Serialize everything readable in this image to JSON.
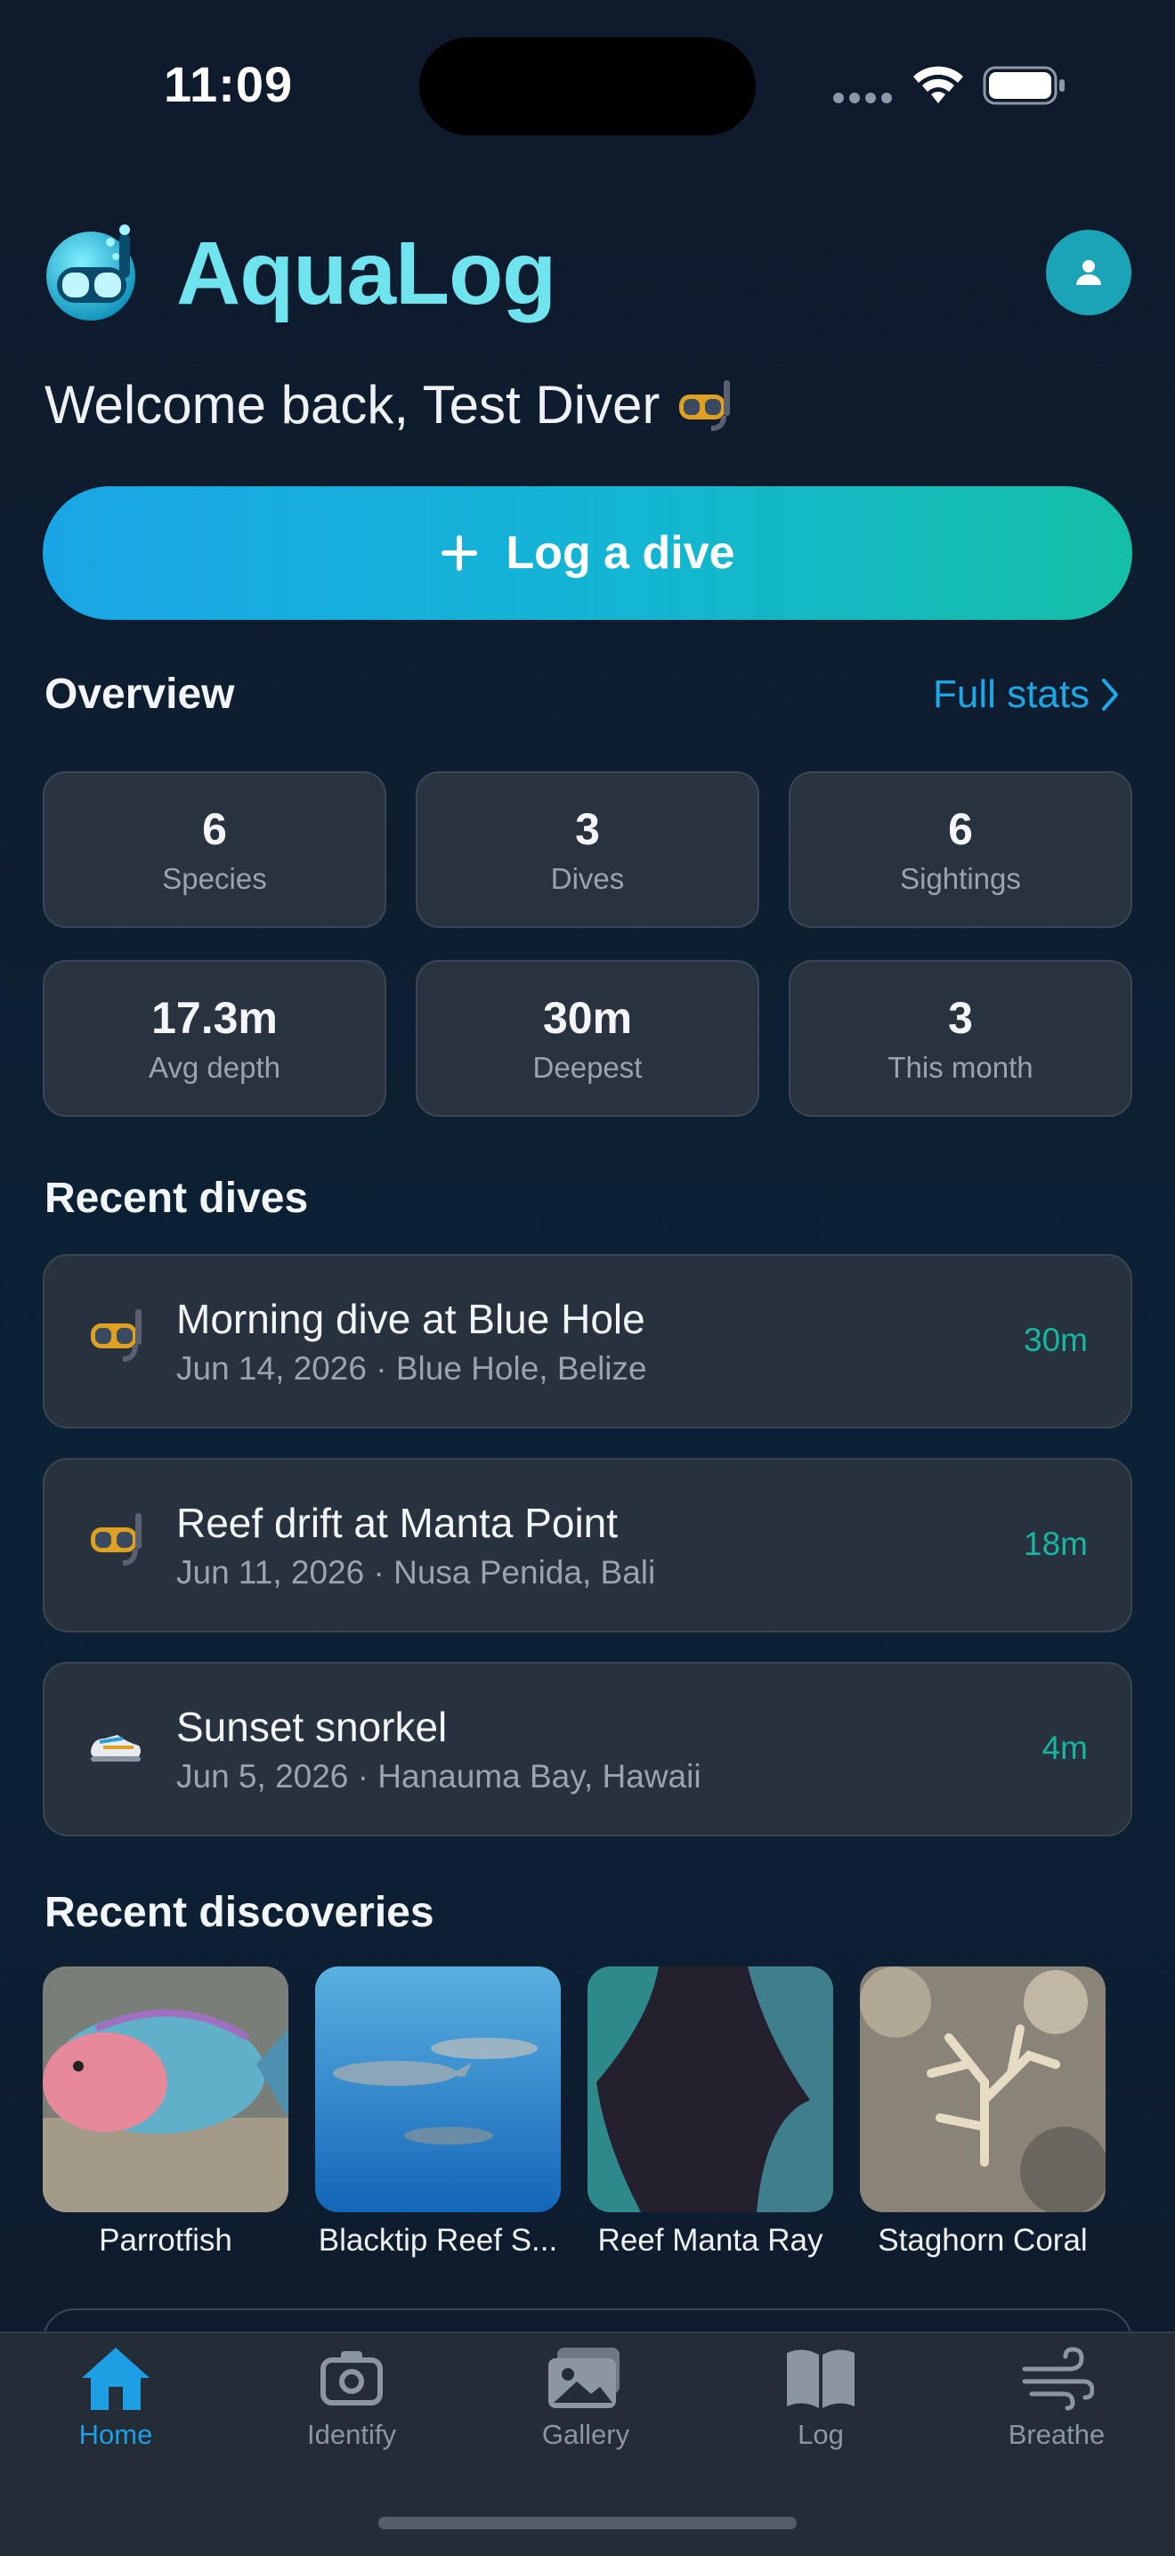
{
  "status_bar": {
    "time": "11:09"
  },
  "header": {
    "app_title": "AquaLog",
    "welcome": "Welcome back, Test Diver"
  },
  "actions": {
    "log_dive_label": "Log a dive"
  },
  "overview": {
    "title": "Overview",
    "full_stats_label": "Full stats",
    "stats": [
      {
        "value": "6",
        "label": "Species"
      },
      {
        "value": "3",
        "label": "Dives"
      },
      {
        "value": "6",
        "label": "Sightings"
      },
      {
        "value": "17.3m",
        "label": "Avg depth"
      },
      {
        "value": "30m",
        "label": "Deepest"
      },
      {
        "value": "3",
        "label": "This month"
      }
    ]
  },
  "recent_dives": {
    "title": "Recent dives",
    "items": [
      {
        "title": "Morning dive at Blue Hole",
        "subtitle": "Jun 14, 2026 · Blue Hole, Belize",
        "depth": "30m",
        "icon": "diving-mask-icon"
      },
      {
        "title": "Reef drift at Manta Point",
        "subtitle": "Jun 11, 2026 · Nusa Penida, Bali",
        "depth": "18m",
        "icon": "diving-mask-icon"
      },
      {
        "title": "Sunset snorkel",
        "subtitle": "Jun 5, 2026 · Hanauma Bay, Hawaii",
        "depth": "4m",
        "icon": "snorkel-shoe-icon"
      }
    ]
  },
  "recent_discoveries": {
    "title": "Recent discoveries",
    "items": [
      {
        "label": "Parrotfish"
      },
      {
        "label": "Blacktip Reef S..."
      },
      {
        "label": "Reef Manta Ray"
      },
      {
        "label": "Staghorn Coral"
      }
    ]
  },
  "tabbar": {
    "active": "Home",
    "tabs": [
      {
        "label": "Home",
        "icon": "home-icon"
      },
      {
        "label": "Identify",
        "icon": "camera-icon"
      },
      {
        "label": "Gallery",
        "icon": "gallery-icon"
      },
      {
        "label": "Log",
        "icon": "book-icon"
      },
      {
        "label": "Breathe",
        "icon": "wind-icon"
      }
    ]
  },
  "colors": {
    "accent": "#1ea7e6",
    "teal": "#17b6a0",
    "title": "#6fe4ef",
    "card": "#28333f"
  }
}
